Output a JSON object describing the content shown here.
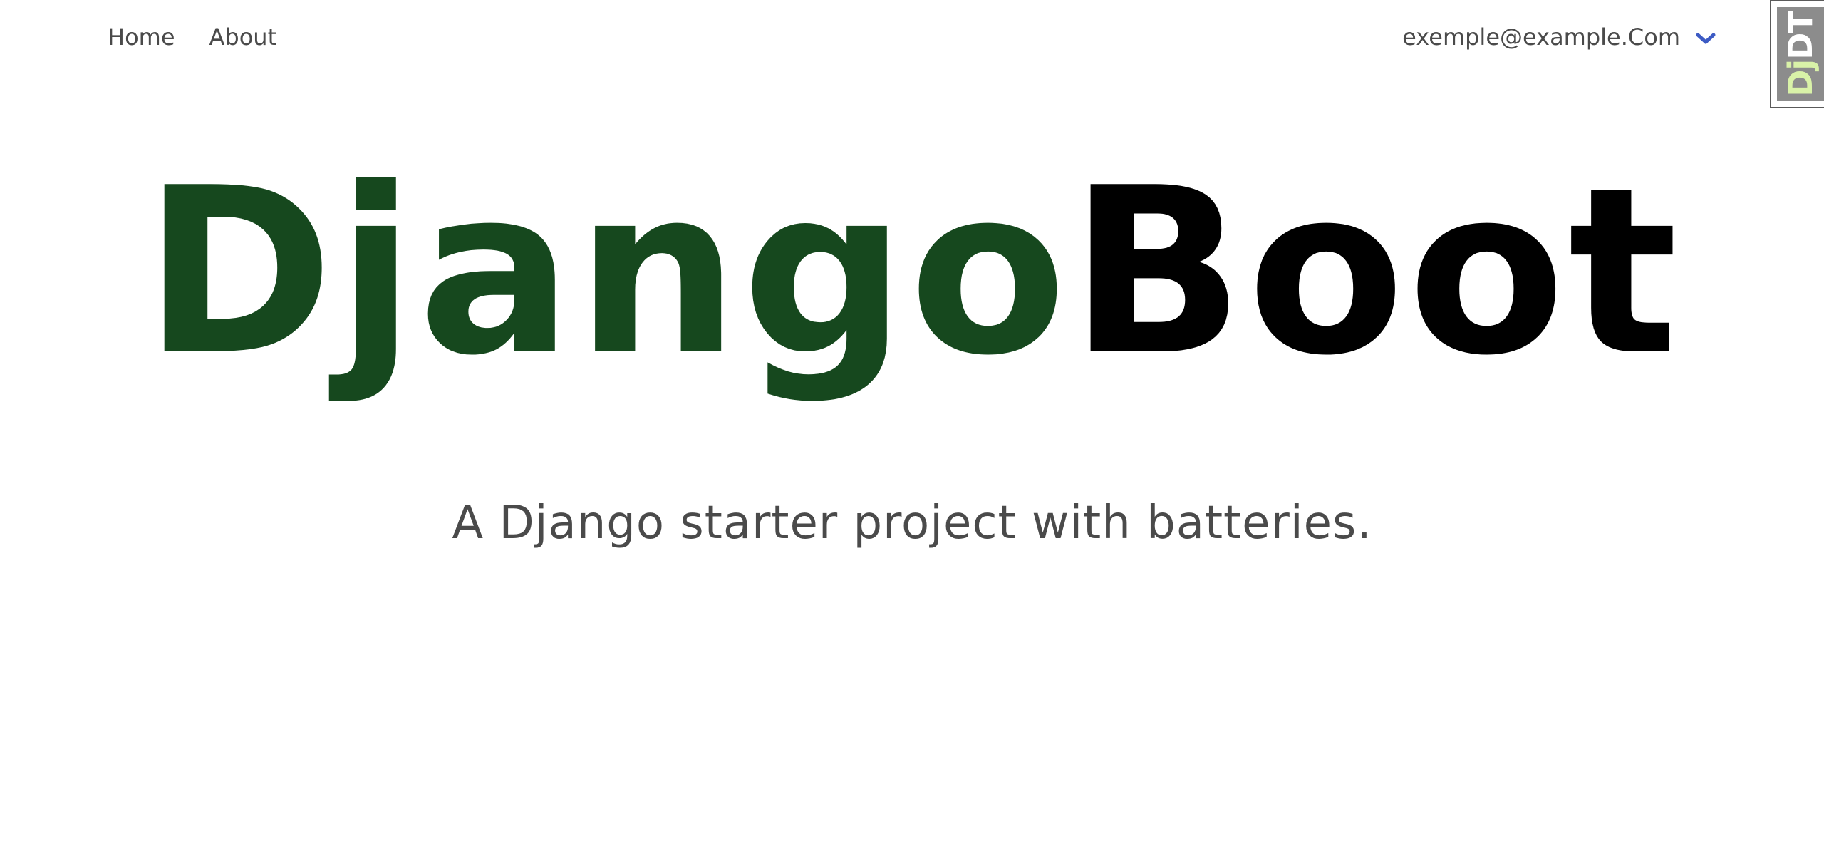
{
  "nav": {
    "links": [
      {
        "label": "Home"
      },
      {
        "label": "About"
      }
    ],
    "user": {
      "email": "exemple@example.Com",
      "dropdown_icon": "chevron-down-icon",
      "icon_color": "#3d5bc4"
    }
  },
  "debug_toolbar": {
    "label_dj": "Dj",
    "label_dt": "DT",
    "bg_color": "#8c8c8c",
    "accent_color": "#d9f2a8"
  },
  "hero": {
    "title_part1": "Django",
    "title_part2": "Boot",
    "title_part1_color": "#16481e",
    "title_part2_color": "#000000",
    "subtitle": "A Django starter project with batteries."
  }
}
